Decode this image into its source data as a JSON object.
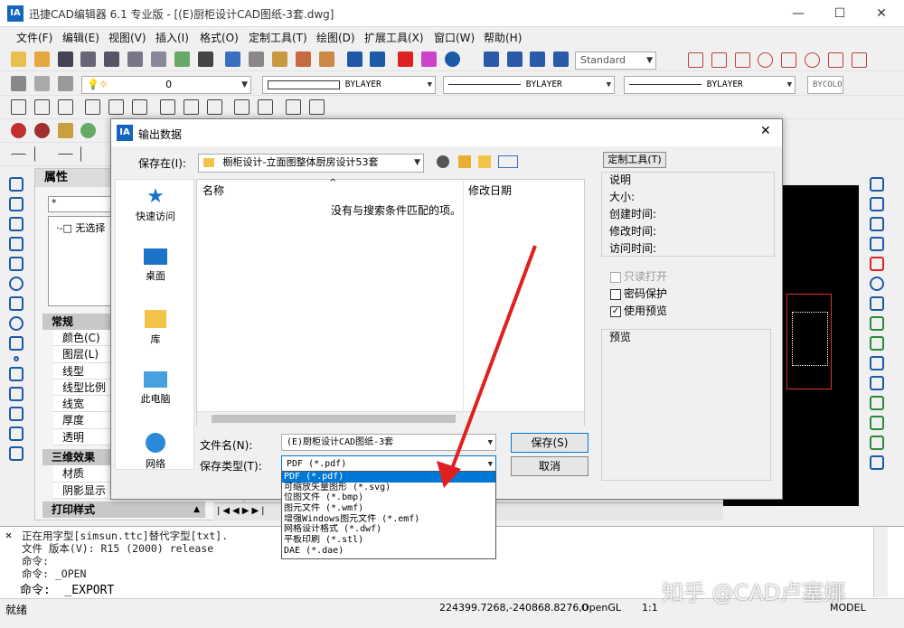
{
  "window": {
    "logo": "IA",
    "title": "迅捷CAD编辑器 6.1 专业版  - [(E)厨柜设计CAD图纸-3套.dwg]",
    "minimize_glyph": "—",
    "maximize_glyph": "☐",
    "close_glyph": "✕"
  },
  "menu": [
    "文件(F)",
    "编辑(E)",
    "视图(V)",
    "插入(I)",
    "格式(O)",
    "定制工具(T)",
    "绘图(D)",
    "扩展工具(X)",
    "窗口(W)",
    "帮助(H)"
  ],
  "toolbar": {
    "text_style": "Standard",
    "layer": "0",
    "color": "BYLAYER",
    "linetype": "BYLAYER",
    "lineweight": "BYLAYER",
    "plotstyle": "BYCOLO"
  },
  "properties": {
    "title": "属性",
    "filter_value": "*",
    "no_selection": "无选择",
    "section_general": "常规",
    "general_rows": [
      "颜色(C)",
      "图层(L)",
      "线型",
      "线型比例",
      "线宽",
      "厚度",
      "透明"
    ],
    "section_3d": "三维效果",
    "rows_3d": [
      "材质",
      "阴影显示"
    ],
    "section_print": "打印样式"
  },
  "dialog": {
    "title": "输出数据",
    "save_in_label": "保存在(I):",
    "save_in_value": "橱柜设计-立面图整体厨房设计53套",
    "custom_tools": "定制工具(T)",
    "places": [
      "快速访问",
      "桌面",
      "库",
      "此电脑",
      "网络"
    ],
    "col_name": "名称",
    "col_modified": "修改日期",
    "empty_message": "没有与搜索条件匹配的项。",
    "info_title": "说明",
    "info_rows": [
      "大小:",
      "创建时间:",
      "修改时间:",
      "访问时间:"
    ],
    "readonly": "只读打开",
    "password": "密码保护",
    "use_preview": "使用预览",
    "preview": "预览",
    "filename_label": "文件名(N):",
    "filename_value": "(E)厨柜设计CAD图纸-3套",
    "filetype_label": "保存类型(T):",
    "filetype_value": "PDF (*.pdf)",
    "save_button": "保存(S)",
    "cancel_button": "取消",
    "filetype_options": [
      "PDF (*.pdf)",
      "可缩放矢量图形 (*.svg)",
      "位图文件 (*.bmp)",
      "图元文件 (*.wmf)",
      "增强Windows图元文件 (*.emf)",
      "网格设计格式 (*.dwf)",
      "平板印刷 (*.stl)",
      "DAE (*.dae)"
    ]
  },
  "command": {
    "lines": [
      "正在用字型[simsun.ttc]替代字型[txt].",
      "文件 版本(V): R15 (2000) release",
      "命令:",
      "命令:  _OPEN"
    ],
    "prompt": "命令:",
    "current": "_EXPORT"
  },
  "status": {
    "ready": "就绪",
    "coords": "224399.7268,-240868.8276,0",
    "opengl": "OpenGL",
    "scale": "1:1",
    "model": "MODEL"
  },
  "watermark": "知乎 @CAD卢塞娜",
  "colors": {
    "accent": "#1565c0",
    "selection": "#0078d7",
    "arrow": "#e02020"
  }
}
